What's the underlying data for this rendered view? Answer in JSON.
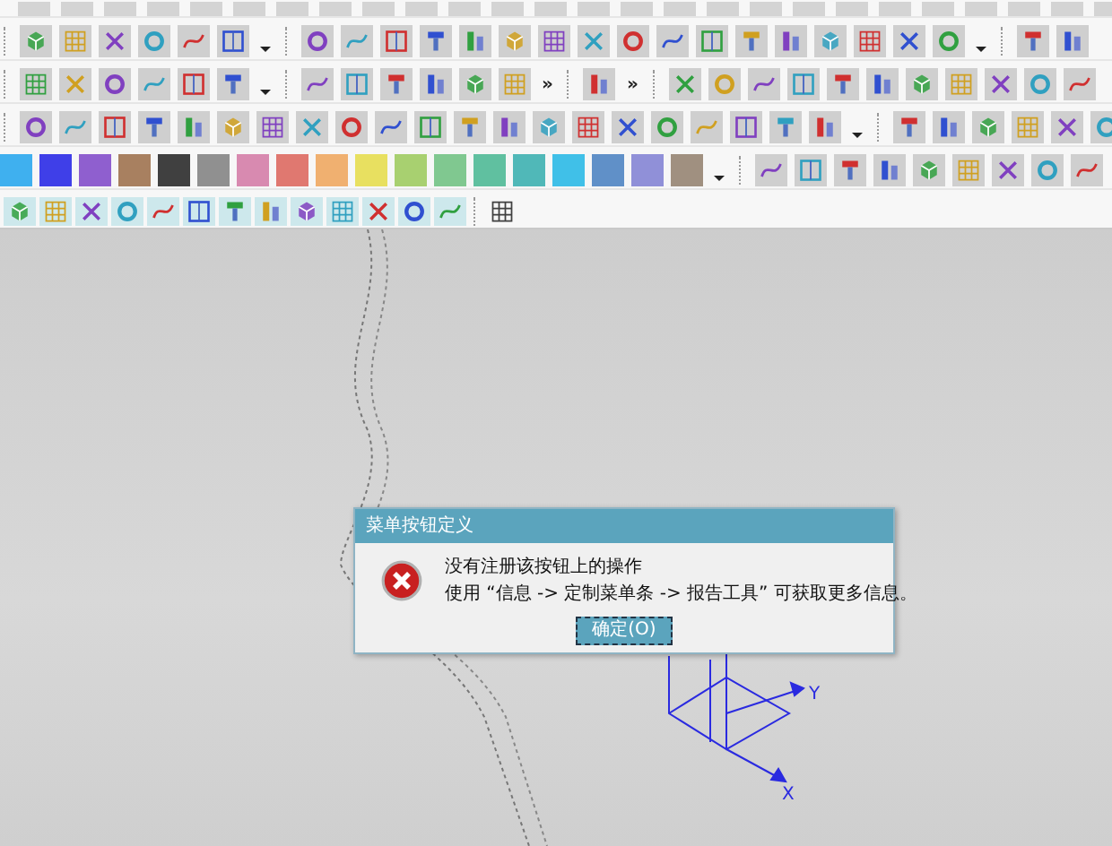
{
  "toolbar": {
    "overflow_markers": [
      "»",
      "»"
    ],
    "color_swatches": [
      {
        "color": "#3fb0ef"
      },
      {
        "color": "#3f3fe8"
      },
      {
        "color": "#8f5fcf"
      },
      {
        "color": "#a88060"
      },
      {
        "color": "#404040"
      },
      {
        "color": "#909090"
      },
      {
        "color": "#d88ab0"
      },
      {
        "color": "#e07870"
      },
      {
        "color": "#f0b070"
      },
      {
        "color": "#e8e060"
      },
      {
        "color": "#a8d070"
      },
      {
        "color": "#80c890"
      },
      {
        "color": "#60c0a0"
      },
      {
        "color": "#50b8b8"
      },
      {
        "color": "#40c0e8"
      },
      {
        "color": "#6090c8"
      },
      {
        "color": "#9090d8"
      },
      {
        "color": "#a09080"
      }
    ]
  },
  "canvas": {
    "axis_labels": [
      "Y",
      "X"
    ]
  },
  "dialog": {
    "title": "菜单按钮定义",
    "message_lines": [
      "没有注册该按钮上的操作",
      "使用 “信息 -> 定制菜单条 -> 报告工具” 可获取更多信息。"
    ],
    "button": "确定(O)"
  }
}
